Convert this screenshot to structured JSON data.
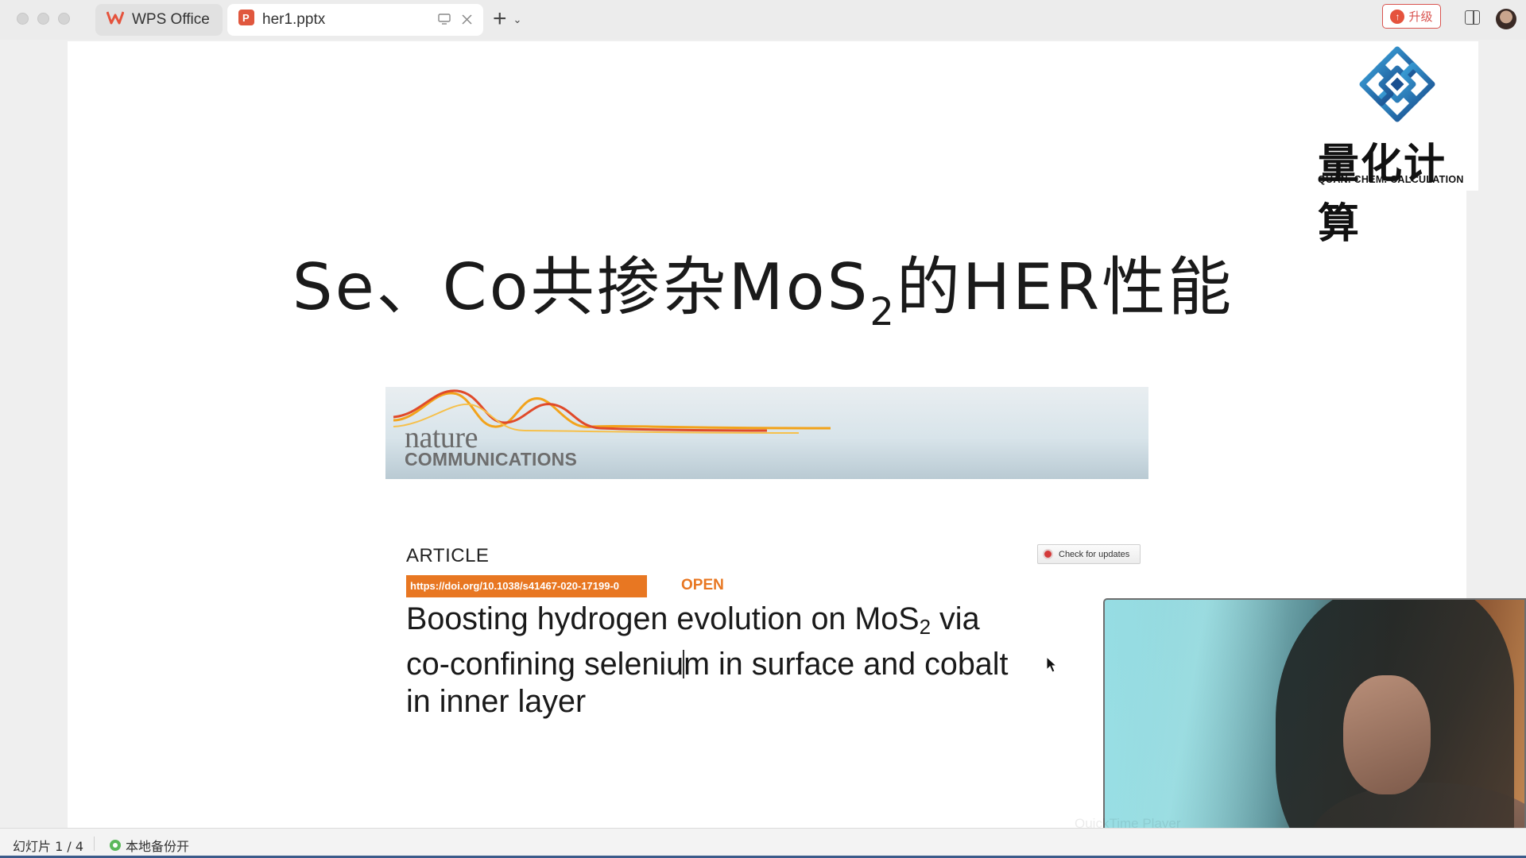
{
  "tabs": [
    {
      "label": "WPS Office",
      "icon": "wps-logo-icon"
    },
    {
      "label": "her1.pptx",
      "icon": "presentation-file-icon"
    }
  ],
  "toolbar": {
    "upgrade_label": "升级"
  },
  "slide": {
    "brand_cn": "量化计算",
    "brand_en": "QUAN. CHEM. CALCULATION",
    "title_part1": "Se、Co共掺杂MoS",
    "title_sub": "2",
    "title_part2": "的HER性能",
    "banner": {
      "nature": "nature",
      "communications": "COMMUNICATIONS"
    },
    "article": {
      "label": "ARTICLE",
      "doi": "https://doi.org/10.1038/s41467-020-17199-0",
      "open": "OPEN",
      "check_updates": "Check for updates",
      "title_line1_a": "Boosting hydrogen evolution on MoS",
      "title_line1_sub": "2",
      "title_line1_b": " via",
      "title_line2_a": "co-confining seleniu",
      "title_line2_b": "m in surface and cobalt",
      "title_line3": "in inner layer"
    }
  },
  "webcam": {
    "watermark": "QuickTime Player"
  },
  "statusbar": {
    "slide_counter": "幻灯片 1 / 4",
    "backup": "本地备份开"
  },
  "colors": {
    "accent_orange": "#e87722",
    "upgrade_red": "#d9534f",
    "wps_red": "#e5533d",
    "brand_blue": "#1f7fbf"
  }
}
